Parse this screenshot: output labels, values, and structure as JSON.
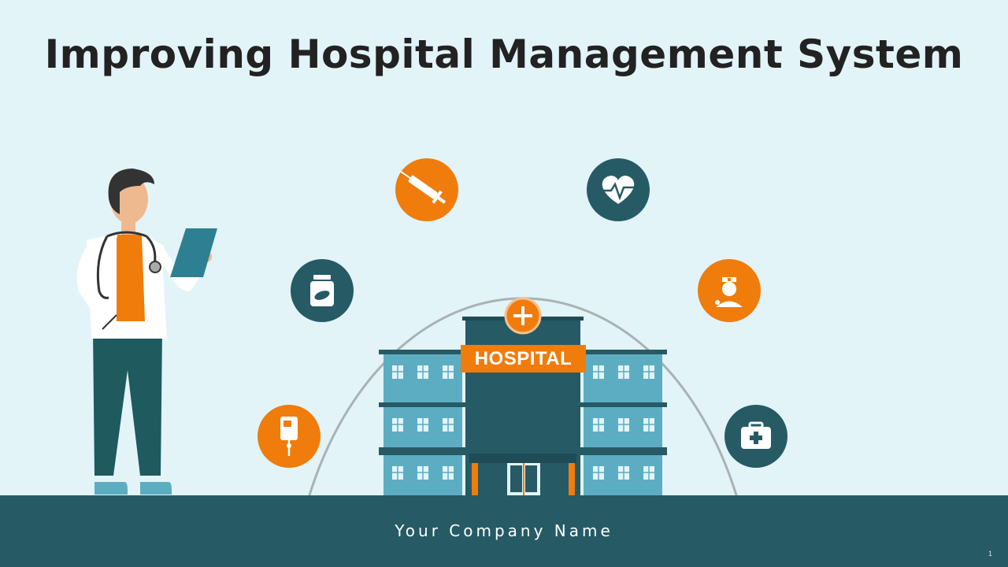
{
  "slide": {
    "title": "Improving Hospital Management System",
    "company_name": "Your Company Name",
    "page_number": "1"
  },
  "building": {
    "sign_text": "HOSPITAL"
  },
  "icons": [
    {
      "name": "syringe-icon",
      "color": "#f07c0c"
    },
    {
      "name": "heart-pulse-icon",
      "color": "#265a65"
    },
    {
      "name": "medicine-bottle-icon",
      "color": "#265a65"
    },
    {
      "name": "nurse-icon",
      "color": "#f07c0c"
    },
    {
      "name": "iv-drip-icon",
      "color": "#f07c0c"
    },
    {
      "name": "first-aid-kit-icon",
      "color": "#265a65"
    }
  ],
  "colors": {
    "background": "#e2f4f8",
    "dark_teal": "#265a65",
    "orange": "#f07c0c",
    "light_blue": "#5dadc2"
  }
}
